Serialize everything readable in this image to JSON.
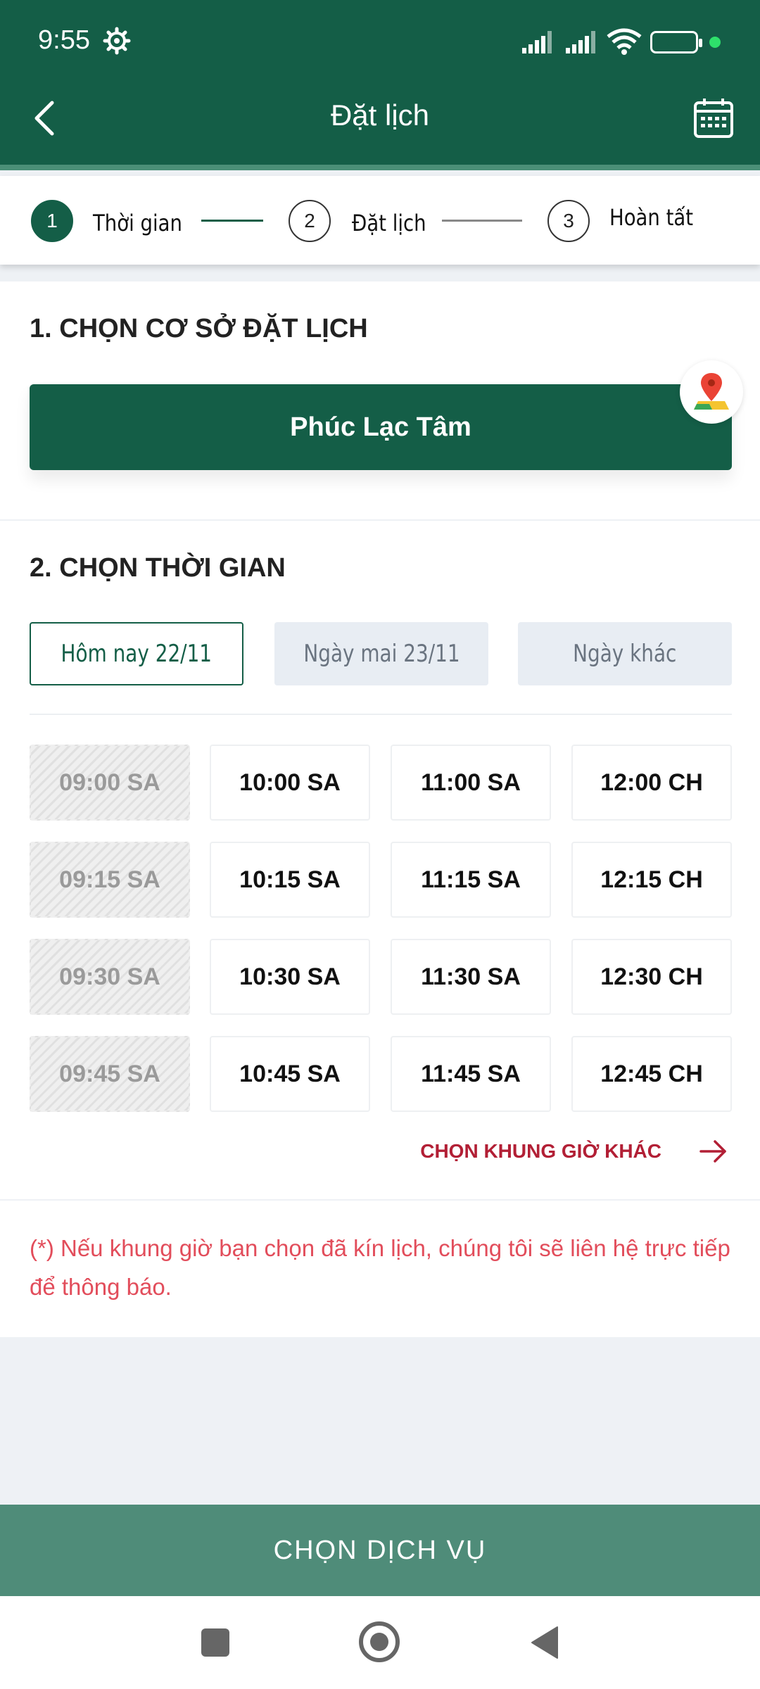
{
  "status_bar": {
    "time": "9:55",
    "battery": "97",
    "battery_level": 0.97
  },
  "header": {
    "title": "Đặt lịch"
  },
  "steps": [
    {
      "number": "1",
      "label": "Thời gian",
      "active": true
    },
    {
      "number": "2",
      "label": "Đặt lịch",
      "active": false
    },
    {
      "number": "3",
      "label": "Hoàn tất",
      "active": false
    }
  ],
  "section1": {
    "title": "1. CHỌN CƠ SỞ ĐẶT LỊCH",
    "branch": "Phúc Lạc Tâm"
  },
  "section2": {
    "title": "2. CHỌN THỜI GIAN",
    "days": [
      {
        "label": "Hôm nay 22/11",
        "selected": true
      },
      {
        "label": "Ngày mai 23/11",
        "selected": false
      },
      {
        "label": "Ngày khác",
        "selected": false
      }
    ],
    "slots": [
      [
        "09:00 SA",
        "10:00 SA",
        "11:00 SA",
        "12:00 CH"
      ],
      [
        "09:15 SA",
        "10:15 SA",
        "11:15 SA",
        "12:15 CH"
      ],
      [
        "09:30 SA",
        "10:30 SA",
        "11:30 SA",
        "12:30 CH"
      ],
      [
        "09:45 SA",
        "10:45 SA",
        "11:45 SA",
        "12:45 CH"
      ]
    ],
    "other_time": "CHỌN KHUNG GIỜ KHÁC"
  },
  "note": "(*) Nếu khung giờ bạn chọn đã kín lịch, chúng tôi sẽ liên hệ trực tiếp để thông báo.",
  "action": {
    "label": "CHỌN DỊCH VỤ"
  },
  "colors": {
    "primary": "#145e47",
    "accent_red": "#b21f35",
    "note_red": "#e24d5b",
    "action_bg": "#4f8c79"
  }
}
